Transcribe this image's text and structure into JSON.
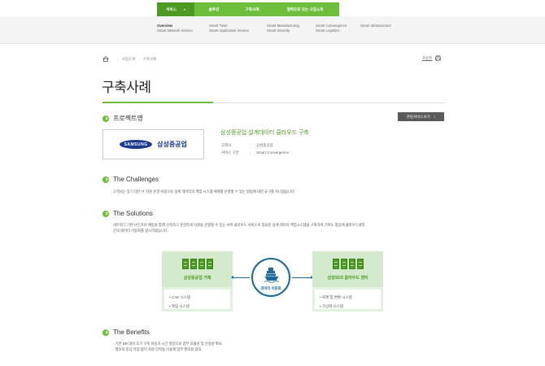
{
  "nav": {
    "tabs": [
      {
        "label": "서비스",
        "caret": "▾"
      },
      {
        "label": "솔루션"
      },
      {
        "label": "구축사례"
      },
      {
        "label": "협력으로 모는 사업소개"
      }
    ]
  },
  "subnav": {
    "col1": [
      "Overview",
      "Smart Network Service"
    ],
    "col2": [
      "Smart Town",
      "Smart Application Service"
    ],
    "col3": [
      "Smart Manufacturing",
      "Smart Security"
    ],
    "col4": [
      "Smart Convergence",
      "Smart Logistics"
    ],
    "col5": [
      "Smart Infrastructure"
    ]
  },
  "breadcrumb": {
    "items": [
      "사업소개",
      "구축사례"
    ],
    "separator": "›"
  },
  "utility": {
    "label": "프린트"
  },
  "page": {
    "title": "구축사례"
  },
  "project": {
    "section": "프로젝트명",
    "related_button": "관련서비스보기",
    "related_chevron": "›",
    "logo_wordmark": "SAMSUNG",
    "logo_korean": "삼성중공업",
    "title": "삼성중공업 설계데이터 클라우드 구축",
    "meta": [
      {
        "key": "고객사",
        "colon": ":",
        "value": "삼성중공업"
      },
      {
        "key": "서비스 구분",
        "colon": ":",
        "value": "Smart Convergence"
      }
    ]
  },
  "challenges": {
    "title": "The Challenges",
    "text": "고객사는 동기 않은 IT 자원 운영 비용으로 설계 데이터의 백업 시스템 체계를 운영할 수 있는 방법에 대한 요구를 지니었습니다."
  },
  "solutions": {
    "title": "The Solutions",
    "lines": [
      "네트워크 기반 IT인프라 예방을 통해 신속하고 유연하게 자원을 운영할 수 있는 서버 클라우드 서비스로 중요한 설계 데이터 백업시스템을 구축하여 기여도 향상에 클라우드센터",
      "간의 데이터 이동화를 실시하였습니다."
    ]
  },
  "diagram": {
    "left": {
      "name": "삼성중공업 거제",
      "items": [
        "• CAD 시스템",
        "• 백업 시스템"
      ]
    },
    "center": {
      "label": "데이터 이동화"
    },
    "right": {
      "name": "삼성SDS 클라우드 센터",
      "items": [
        "• 복제 및 변환 시스템",
        "• 가상화 시스템"
      ]
    }
  },
  "benefits": {
    "title": "The Benefits",
    "items": [
      "- 기존 DR 대비 초기 구축 비용과 시간 절감으로 업무 효율성 및 안정성 확보",
      "- 별보의 중상 작업 없이 자원 탄력을 이용해 업무 편의성 증대"
    ]
  },
  "colors": {
    "accent": "#6dbe3b",
    "accent_dark": "#4d9a22",
    "cloud_blue": "#1e6b99",
    "samsung_blue": "#1b3c8c"
  }
}
